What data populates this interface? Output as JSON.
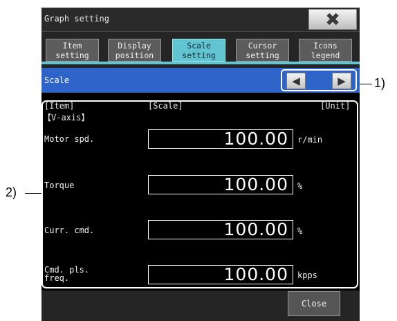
{
  "window": {
    "title": "Graph setting",
    "close_icon": "close-x-icon"
  },
  "tabs": [
    {
      "label": "Item\nsetting",
      "active": false
    },
    {
      "label": "Display\nposition",
      "active": false
    },
    {
      "label": "Scale\nsetting",
      "active": true
    },
    {
      "label": "Cursor\nsetting",
      "active": false
    },
    {
      "label": "Icons\nlegend",
      "active": false
    }
  ],
  "scale_bar": {
    "label": "Scale",
    "prev_icon": "triangle-left-icon",
    "next_icon": "triangle-right-icon"
  },
  "columns": {
    "item": "[Item]",
    "scale": "[Scale]",
    "unit": "[Unit]"
  },
  "axis_label": "【V-axis】",
  "rows": [
    {
      "label": "Motor spd.",
      "value": "100.00",
      "unit": "r/min"
    },
    {
      "label": "Torque",
      "value": "100.00",
      "unit": "%"
    },
    {
      "label": "Curr. cmd.",
      "value": "100.00",
      "unit": "%"
    },
    {
      "label": "Cmd. pls.\nfreq.",
      "value": "100.00",
      "unit": "kpps"
    }
  ],
  "close_button": "Close",
  "callouts": {
    "nav": "1)",
    "list": "2)"
  },
  "colors": {
    "accent_tab": "#62c4d0",
    "scale_bar": "#2e64c8",
    "background": "#000000"
  }
}
